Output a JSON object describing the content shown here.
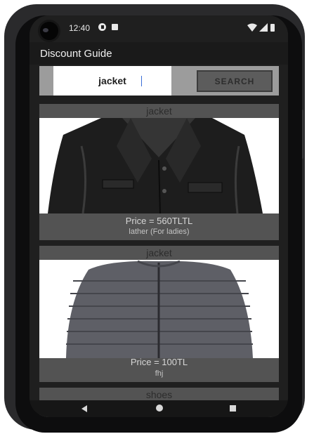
{
  "status_bar": {
    "time": "12:40"
  },
  "app": {
    "title": "Discount Guide"
  },
  "search": {
    "query": "jacket",
    "button_label": "SEARCH"
  },
  "products": [
    {
      "name": "jacket",
      "price": "Price = 560TLTL",
      "description": "lather (For ladies)",
      "image": "black-leather-jacket"
    },
    {
      "name": "jacket",
      "price": "Price = 100TL",
      "description": "fhj",
      "image": "grey-puffer-jacket"
    },
    {
      "name": "shoes"
    }
  ],
  "nav_bar": {
    "buttons": [
      "back",
      "home",
      "recents"
    ]
  },
  "colors": {
    "screen_background": "#1f1f1f",
    "search_strip": "#9c9c9c",
    "card_background": "#535353",
    "search_button": "#5c5c5c"
  }
}
